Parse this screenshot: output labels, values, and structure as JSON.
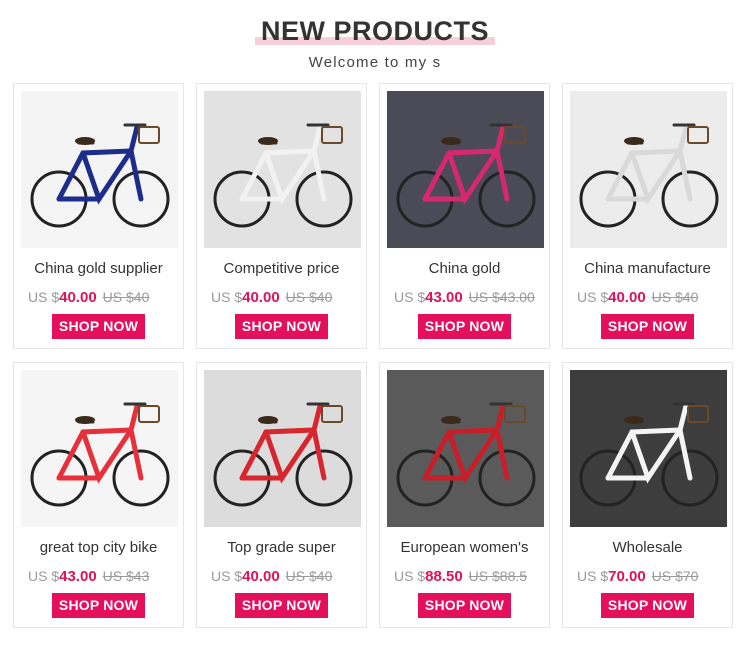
{
  "header": {
    "title": "NEW PRODUCTS",
    "subtitle": "Welcome to my s"
  },
  "products": [
    {
      "name": "China gold supplier",
      "currency": "US $",
      "price": "40.00",
      "old_price": "US $40",
      "button": "SHOP NOW",
      "bike_color": "#1e2d8c",
      "bg": "#f4f4f4"
    },
    {
      "name": "Competitive price",
      "currency": "US $",
      "price": "40.00",
      "old_price": "US $40",
      "button": "SHOP NOW",
      "bike_color": "#f2f2f2",
      "bg": "#e2e2e2"
    },
    {
      "name": "China gold",
      "currency": "US $",
      "price": "43.00",
      "old_price": "US $43.00",
      "button": "SHOP NOW",
      "bike_color": "#d6286e",
      "bg": "#4b4b57"
    },
    {
      "name": "China manufacture",
      "currency": "US $",
      "price": "40.00",
      "old_price": "US $40",
      "button": "SHOP NOW",
      "bike_color": "#d9d9d9",
      "bg": "#ececec"
    },
    {
      "name": "great top city bike",
      "currency": "US $",
      "price": "43.00",
      "old_price": "US $43",
      "button": "SHOP NOW",
      "bike_color": "#e6303b",
      "bg": "#f5f5f5"
    },
    {
      "name": "Top grade super",
      "currency": "US $",
      "price": "40.00",
      "old_price": "US $40",
      "button": "SHOP NOW",
      "bike_color": "#d7262e",
      "bg": "#dcdcdc"
    },
    {
      "name": "European women's",
      "currency": "US $",
      "price": "88.50",
      "old_price": "US $88.5",
      "button": "SHOP NOW",
      "bike_color": "#c81e2a",
      "bg": "#5a5a5a"
    },
    {
      "name": "Wholesale",
      "currency": "US $",
      "price": "70.00",
      "old_price": "US $70",
      "button": "SHOP NOW",
      "bike_color": "#f4f4f4",
      "bg": "#3d3d3d"
    }
  ]
}
